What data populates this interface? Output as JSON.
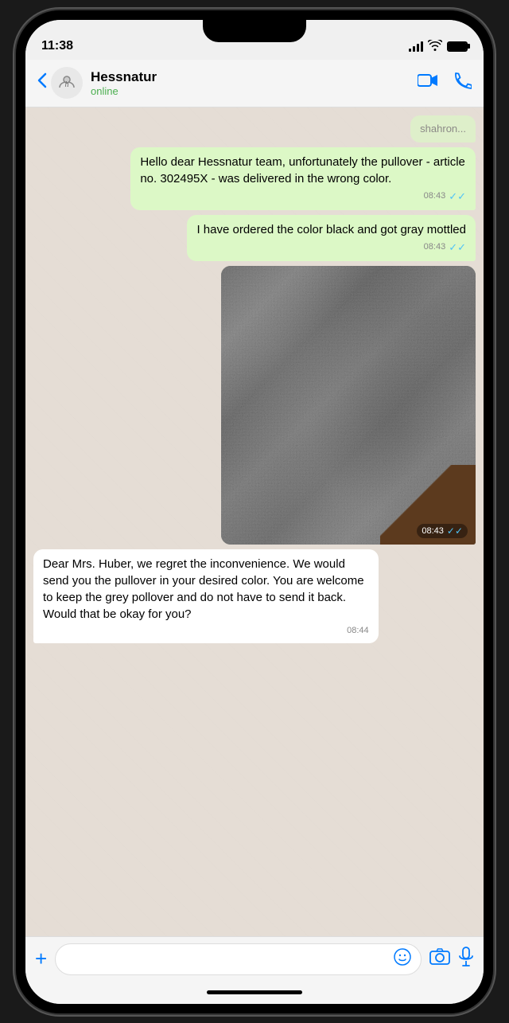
{
  "status_bar": {
    "time": "11:38"
  },
  "header": {
    "back_label": "‹",
    "contact_initial": "h",
    "contact_name": "Hessnatur",
    "contact_status": "online",
    "video_icon": "📹",
    "phone_icon": "📞"
  },
  "chat": {
    "truncated_text": "shahron...",
    "messages": [
      {
        "id": "msg1",
        "type": "sent",
        "text": "Hello dear Hessnatur team, unfortunately the pullover - article no. 302495X - was delivered in the wrong color.",
        "time": "08:43",
        "read": true
      },
      {
        "id": "msg2",
        "type": "sent",
        "text": "I have ordered the color black and got gray mottled",
        "time": "08:43",
        "read": true
      },
      {
        "id": "msg3",
        "type": "sent_image",
        "time": "08:43",
        "read": true
      },
      {
        "id": "msg4",
        "type": "received",
        "text": "Dear Mrs. Huber, we regret the inconvenience. We would send you the pullover in your desired color. You are welcome to keep the grey pollover and do not have to send it back. Would that be okay for you?",
        "time": "08:44",
        "read": false
      }
    ]
  },
  "input_bar": {
    "plus_icon": "+",
    "placeholder": "",
    "sticker_icon": "sticker",
    "camera_icon": "camera",
    "mic_icon": "mic"
  }
}
